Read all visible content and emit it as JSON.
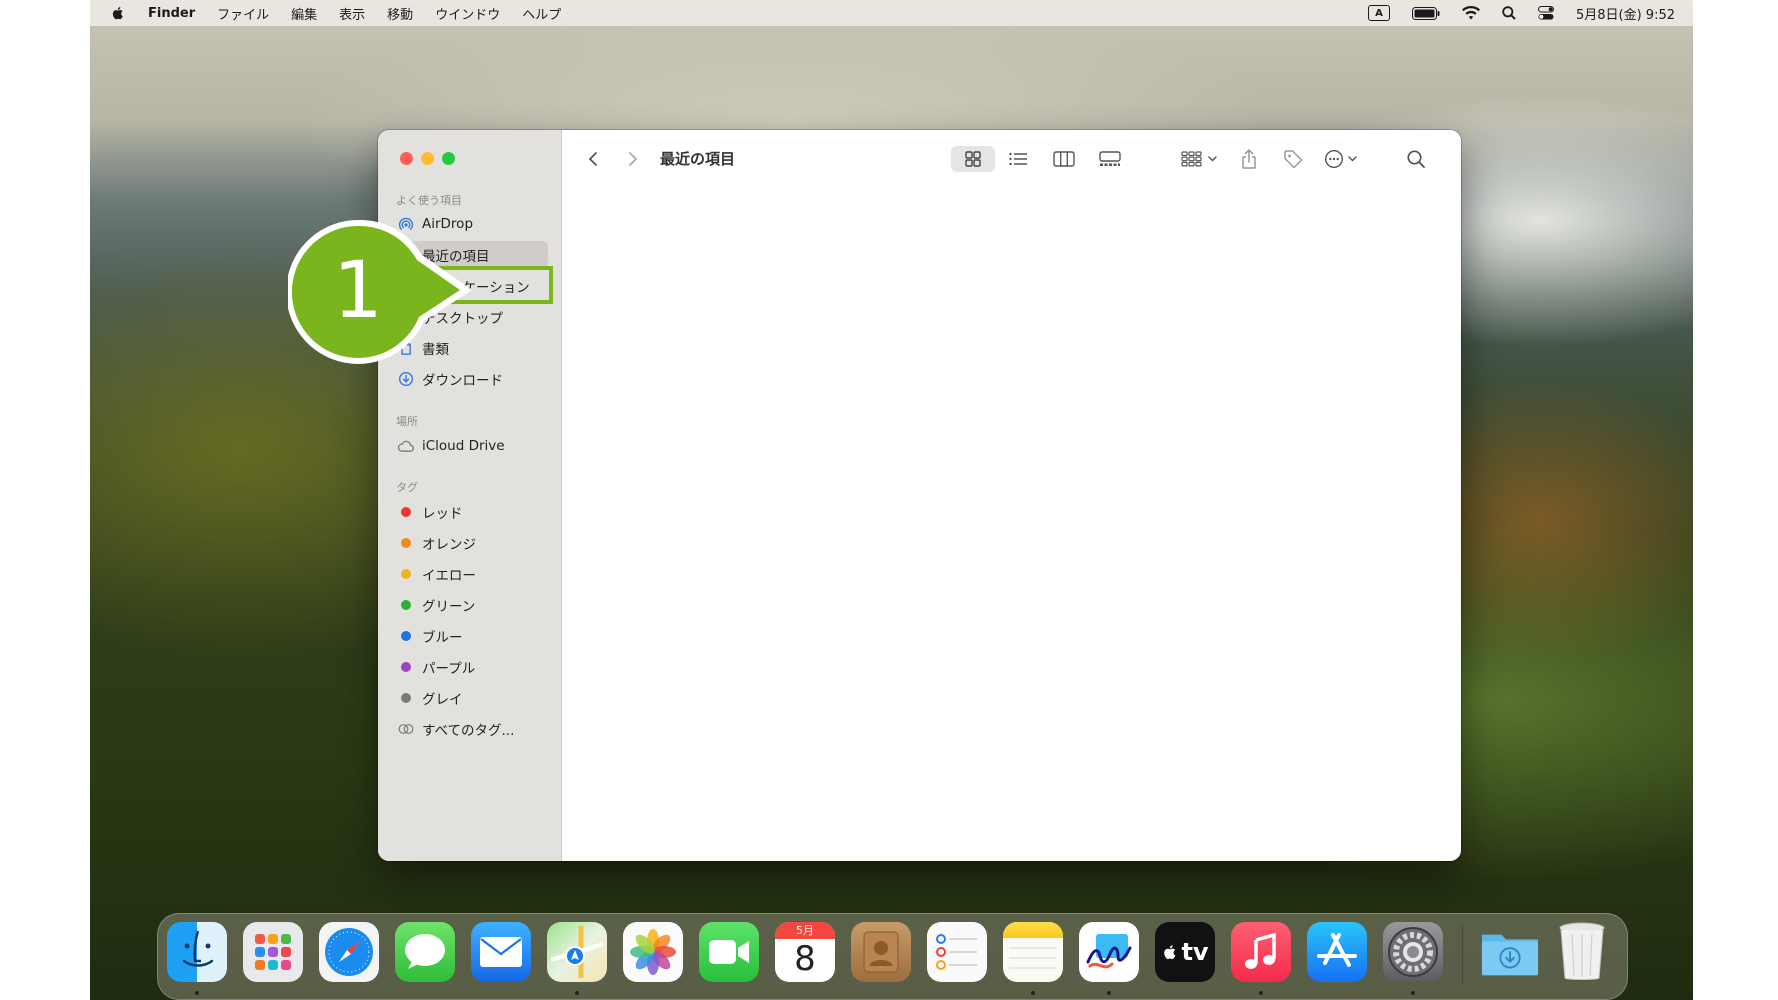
{
  "menubar": {
    "app_name": "Finder",
    "items": [
      "ファイル",
      "編集",
      "表示",
      "移動",
      "ウインドウ",
      "ヘルプ"
    ],
    "input_indicator": "A",
    "clock": "5月8日(金) 9:52"
  },
  "window": {
    "title": "最近の項目",
    "sidebar": {
      "favorites_header": "よく使う項目",
      "favorites": [
        {
          "label": "AirDrop"
        },
        {
          "label": "最近の項目"
        },
        {
          "label": "アプリケーション"
        },
        {
          "label": "デスクトップ"
        },
        {
          "label": "書類"
        },
        {
          "label": "ダウンロード"
        }
      ],
      "locations_header": "場所",
      "locations": [
        {
          "label": "iCloud Drive"
        }
      ],
      "tags_header": "タグ",
      "tags": [
        {
          "label": "レッド",
          "color": "#e8372f"
        },
        {
          "label": "オレンジ",
          "color": "#f08a1c"
        },
        {
          "label": "イエロー",
          "color": "#e8b819"
        },
        {
          "label": "グリーン",
          "color": "#2fae3a"
        },
        {
          "label": "ブルー",
          "color": "#1f6fe8"
        },
        {
          "label": "パープル",
          "color": "#9b45c4"
        },
        {
          "label": "グレイ",
          "color": "#7a7a7a"
        }
      ],
      "all_tags": "すべてのタグ..."
    }
  },
  "callout": {
    "number": "1",
    "color": "#7ab51d"
  },
  "dock": {
    "calendar_month": "5月",
    "calendar_day": "8",
    "tv_label": "tv"
  }
}
